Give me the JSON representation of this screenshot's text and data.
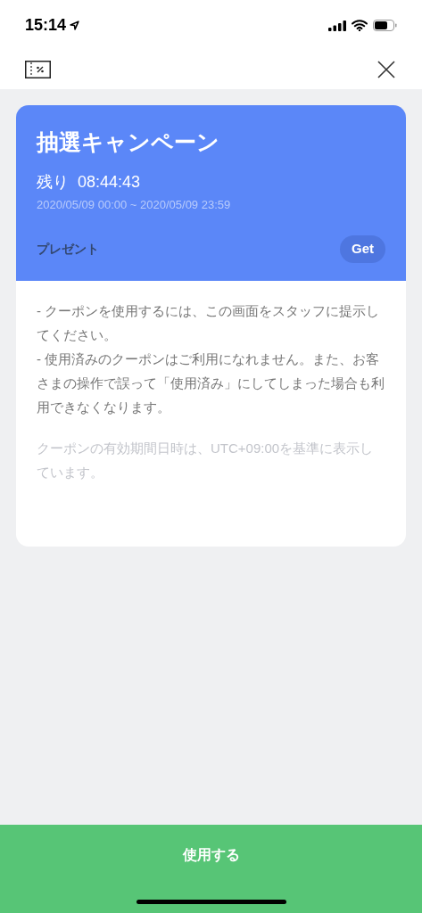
{
  "status_bar": {
    "time": "15:14"
  },
  "coupon": {
    "title": "抽選キャンペーン",
    "remaining_label": "残り",
    "remaining_time": "08:44:43",
    "period": "2020/05/09 00:00 ~ 2020/05/09 23:59",
    "type_label": "プレゼント",
    "action": "Get"
  },
  "notes": [
    "- クーポンを使用するには、この画面をスタッフに提示してください。",
    "- 使用済みのクーポンはご利用になれません。また、お客さまの操作で誤って「使用済み」にしてしまった場合も利用できなくなります。"
  ],
  "timezone_note": "クーポンの有効期間日時は、UTC+09:00を基準に表示しています。",
  "use_button": "使用する"
}
